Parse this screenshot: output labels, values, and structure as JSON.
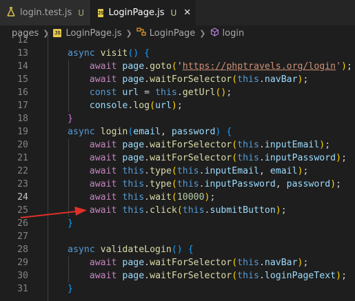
{
  "tabs": [
    {
      "label": "login.test.js",
      "status": "U",
      "icon": "flask-icon"
    },
    {
      "label": "LoginPage.js",
      "status": "U",
      "icon": "js-file-icon",
      "close": "✕"
    }
  ],
  "breadcrumb": {
    "js_badge": "JS",
    "items": [
      "pages",
      "LoginPage.js",
      "LoginPage",
      "login"
    ]
  },
  "editor": {
    "active_line": "24",
    "lines": [
      {
        "n": "11",
        "tokens": [
          [
            "}",
            "br3"
          ]
        ]
      },
      {
        "n": "12",
        "tokens": []
      },
      {
        "n": "13",
        "tokens": [
          [
            "async ",
            "kw"
          ],
          [
            "visit",
            "fn"
          ],
          [
            "() ",
            "br3"
          ],
          [
            "{",
            "br3"
          ]
        ]
      },
      {
        "n": "14",
        "tokens": [
          [
            "    "
          ],
          [
            "await ",
            "ctl"
          ],
          [
            "page",
            "var"
          ],
          [
            "."
          ],
          [
            "goto",
            "fn"
          ],
          [
            "(",
            "br1"
          ],
          [
            "'"
          ],
          [
            "https://phptravels.org/login",
            "str link"
          ],
          [
            "'",
            "str"
          ],
          [
            ")",
            "br1"
          ],
          [
            ";"
          ]
        ]
      },
      {
        "n": "15",
        "tokens": [
          [
            "    "
          ],
          [
            "await ",
            "ctl"
          ],
          [
            "page",
            "var"
          ],
          [
            "."
          ],
          [
            "waitForSelector",
            "fn"
          ],
          [
            "(",
            "br1"
          ],
          [
            "this",
            "kw"
          ],
          [
            "."
          ],
          [
            "navBar",
            "var"
          ],
          [
            ")",
            "br1"
          ],
          [
            ";"
          ]
        ]
      },
      {
        "n": "16",
        "tokens": [
          [
            "    "
          ],
          [
            "const ",
            "kw"
          ],
          [
            "url",
            "var"
          ],
          [
            " = "
          ],
          [
            "this",
            "kw"
          ],
          [
            "."
          ],
          [
            "getUrl",
            "fn"
          ],
          [
            "()",
            "br1"
          ],
          [
            ";"
          ]
        ]
      },
      {
        "n": "17",
        "tokens": [
          [
            "    "
          ],
          [
            "console",
            "var"
          ],
          [
            "."
          ],
          [
            "log",
            "fn"
          ],
          [
            "(",
            "br1"
          ],
          [
            "url",
            "var"
          ],
          [
            ")",
            "br1"
          ],
          [
            ";"
          ]
        ]
      },
      {
        "n": "18",
        "tokens": [
          [
            "}",
            "br2"
          ]
        ]
      },
      {
        "n": "19",
        "tokens": [
          [
            "async ",
            "kw"
          ],
          [
            "login",
            "fn"
          ],
          [
            "(",
            "br3"
          ],
          [
            "email",
            "var"
          ],
          [
            ", "
          ],
          [
            "password",
            "var"
          ],
          [
            ") ",
            "br3"
          ],
          [
            "{",
            "br3"
          ]
        ]
      },
      {
        "n": "20",
        "tokens": [
          [
            "    "
          ],
          [
            "await ",
            "ctl"
          ],
          [
            "page",
            "var"
          ],
          [
            "."
          ],
          [
            "waitForSelector",
            "fn"
          ],
          [
            "(",
            "br1"
          ],
          [
            "this",
            "kw"
          ],
          [
            "."
          ],
          [
            "inputEmail",
            "var"
          ],
          [
            ")",
            "br1"
          ],
          [
            ";"
          ]
        ]
      },
      {
        "n": "21",
        "tokens": [
          [
            "    "
          ],
          [
            "await ",
            "ctl"
          ],
          [
            "page",
            "var"
          ],
          [
            "."
          ],
          [
            "waitForSelector",
            "fn"
          ],
          [
            "(",
            "br1"
          ],
          [
            "this",
            "kw"
          ],
          [
            "."
          ],
          [
            "inputPassword",
            "var"
          ],
          [
            ")",
            "br1"
          ],
          [
            ";"
          ]
        ]
      },
      {
        "n": "22",
        "tokens": [
          [
            "    "
          ],
          [
            "await ",
            "ctl"
          ],
          [
            "this",
            "kw"
          ],
          [
            "."
          ],
          [
            "type",
            "fn"
          ],
          [
            "(",
            "br1"
          ],
          [
            "this",
            "kw"
          ],
          [
            "."
          ],
          [
            "inputEmail",
            "var"
          ],
          [
            ", "
          ],
          [
            "email",
            "var"
          ],
          [
            ")",
            "br1"
          ],
          [
            ";"
          ]
        ]
      },
      {
        "n": "23",
        "tokens": [
          [
            "    "
          ],
          [
            "await ",
            "ctl"
          ],
          [
            "this",
            "kw"
          ],
          [
            "."
          ],
          [
            "type",
            "fn"
          ],
          [
            "(",
            "br1"
          ],
          [
            "this",
            "kw"
          ],
          [
            "."
          ],
          [
            "inputPassword",
            "var"
          ],
          [
            ", "
          ],
          [
            "password",
            "var"
          ],
          [
            ")",
            "br1"
          ],
          [
            ";"
          ]
        ]
      },
      {
        "n": "24",
        "tokens": [
          [
            "    "
          ],
          [
            "await ",
            "ctl"
          ],
          [
            "this",
            "kw"
          ],
          [
            "."
          ],
          [
            "wait",
            "fn"
          ],
          [
            "(",
            "br1"
          ],
          [
            "10000",
            "num"
          ],
          [
            ")",
            "br1"
          ],
          [
            ";"
          ]
        ]
      },
      {
        "n": "25",
        "tokens": [
          [
            "    "
          ],
          [
            "await ",
            "ctl"
          ],
          [
            "this",
            "kw"
          ],
          [
            "."
          ],
          [
            "click",
            "fn"
          ],
          [
            "(",
            "br1"
          ],
          [
            "this",
            "kw"
          ],
          [
            "."
          ],
          [
            "submitButton",
            "var"
          ],
          [
            ")",
            "br1"
          ],
          [
            ";"
          ]
        ]
      },
      {
        "n": "26",
        "tokens": [
          [
            "}",
            "br3"
          ]
        ]
      },
      {
        "n": "27",
        "tokens": []
      },
      {
        "n": "28",
        "tokens": [
          [
            "async ",
            "kw"
          ],
          [
            "validateLogin",
            "fn"
          ],
          [
            "() ",
            "br3"
          ],
          [
            "{",
            "br3"
          ]
        ]
      },
      {
        "n": "29",
        "tokens": [
          [
            "    "
          ],
          [
            "await ",
            "ctl"
          ],
          [
            "page",
            "var"
          ],
          [
            "."
          ],
          [
            "waitForSelector",
            "fn"
          ],
          [
            "(",
            "br1"
          ],
          [
            "this",
            "kw"
          ],
          [
            "."
          ],
          [
            "navBar",
            "var"
          ],
          [
            ")",
            "br1"
          ],
          [
            ";"
          ]
        ]
      },
      {
        "n": "30",
        "tokens": [
          [
            "    "
          ],
          [
            "await ",
            "ctl"
          ],
          [
            "page",
            "var"
          ],
          [
            "."
          ],
          [
            "waitForSelector",
            "fn"
          ],
          [
            "(",
            "br1"
          ],
          [
            "this",
            "kw"
          ],
          [
            "."
          ],
          [
            "loginPageText",
            "var"
          ],
          [
            ")",
            "br1"
          ],
          [
            ";"
          ]
        ]
      },
      {
        "n": "31",
        "tokens": [
          [
            "}",
            "br3"
          ]
        ]
      }
    ]
  },
  "annotation": {
    "color": "#e0302a",
    "icon": "red-arrow"
  },
  "colors": {
    "accent_js": "#e3c84c",
    "flask": "#e3c84c",
    "symbol_class": "#ee9d28",
    "symbol_method": "#b180d7"
  }
}
